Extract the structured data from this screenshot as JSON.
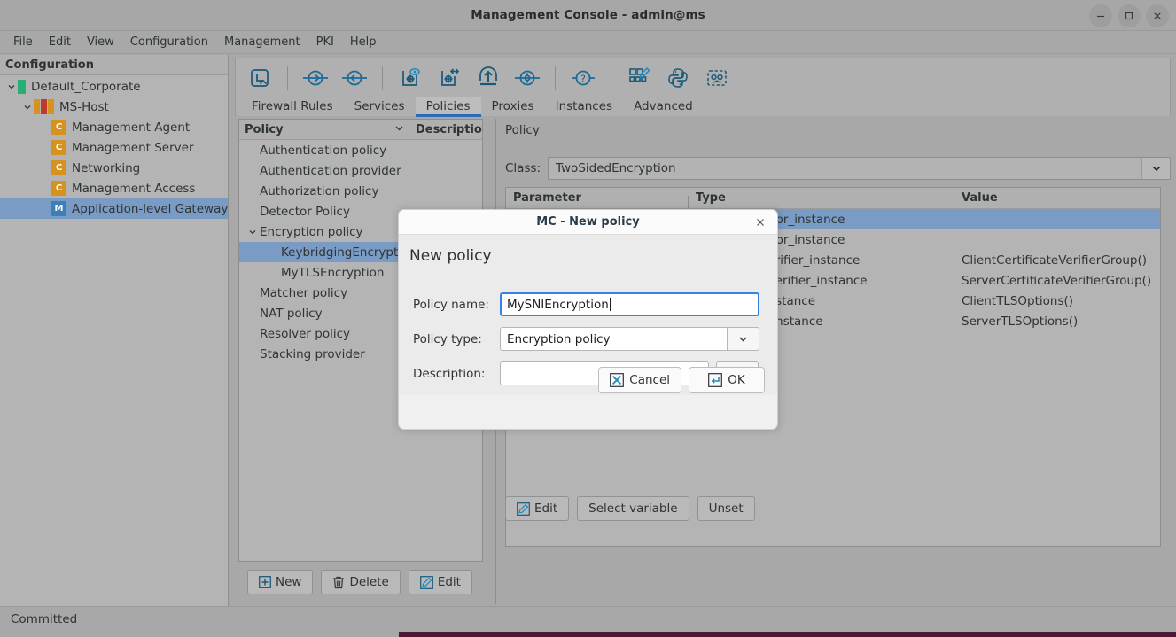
{
  "window": {
    "title": "Management Console - admin@ms",
    "controls": {
      "minimize": "minimize-icon",
      "maximize": "maximize-icon",
      "close": "close-icon"
    }
  },
  "menubar": {
    "items": [
      "File",
      "Edit",
      "View",
      "Configuration",
      "Management",
      "PKI",
      "Help"
    ]
  },
  "sidebar": {
    "header": "Configuration",
    "items": [
      {
        "label": "Default_Corporate",
        "depth": 0,
        "icon": "green-bar",
        "expanded": true,
        "selected": false
      },
      {
        "label": "MS-Host",
        "depth": 1,
        "icon": "triple-bar",
        "expanded": true,
        "selected": false
      },
      {
        "label": "Management Agent",
        "depth": 2,
        "icon": "c-badge",
        "expanded": null,
        "selected": false
      },
      {
        "label": "Management Server",
        "depth": 2,
        "icon": "c-badge",
        "expanded": null,
        "selected": false
      },
      {
        "label": "Networking",
        "depth": 2,
        "icon": "c-badge",
        "expanded": null,
        "selected": false
      },
      {
        "label": "Management Access",
        "depth": 2,
        "icon": "c-badge",
        "expanded": null,
        "selected": false
      },
      {
        "label": "Application-level Gateway",
        "depth": 2,
        "icon": "m-badge",
        "expanded": null,
        "selected": true
      }
    ]
  },
  "toolbar": {
    "icons": [
      "go-up-icon",
      "separator",
      "forward-arrow-icon",
      "back-arrow-icon",
      "separator",
      "preview-config-icon",
      "apply-config-icon",
      "upload-icon",
      "settings-icon",
      "separator",
      "help-icon",
      "separator",
      "edit-grid-icon",
      "python-icon",
      "bot-icon"
    ],
    "tabs": [
      {
        "label": "Firewall Rules",
        "active": false
      },
      {
        "label": "Services",
        "active": false
      },
      {
        "label": "Policies",
        "active": true
      },
      {
        "label": "Proxies",
        "active": false
      },
      {
        "label": "Instances",
        "active": false
      },
      {
        "label": "Advanced",
        "active": false
      }
    ],
    "accent_color": "#2d6cb5"
  },
  "policy_panel": {
    "columns": [
      "Policy",
      "Description"
    ],
    "items": [
      {
        "label": "Authentication policy",
        "depth": 1,
        "expandable": false,
        "selected": false
      },
      {
        "label": "Authentication provider",
        "depth": 1,
        "expandable": false,
        "selected": false
      },
      {
        "label": "Authorization policy",
        "depth": 1,
        "expandable": false,
        "selected": false
      },
      {
        "label": "Detector Policy",
        "depth": 1,
        "expandable": false,
        "selected": false
      },
      {
        "label": "Encryption policy",
        "depth": 1,
        "expandable": true,
        "expanded": true,
        "selected": false
      },
      {
        "label": "KeybridgingEncryption",
        "depth": 2,
        "expandable": false,
        "selected": true
      },
      {
        "label": "MyTLSEncryption",
        "depth": 2,
        "expandable": false,
        "selected": false
      },
      {
        "label": "Matcher policy",
        "depth": 1,
        "expandable": false,
        "selected": false
      },
      {
        "label": "NAT policy",
        "depth": 1,
        "expandable": false,
        "selected": false
      },
      {
        "label": "Resolver policy",
        "depth": 1,
        "expandable": false,
        "selected": false
      },
      {
        "label": "Stacking provider",
        "depth": 1,
        "expandable": false,
        "selected": false
      }
    ],
    "buttons": [
      {
        "label": "New",
        "icon": "plus-icon"
      },
      {
        "label": "Delete",
        "icon": "trash-icon"
      },
      {
        "label": "Edit",
        "icon": "pencil-icon"
      }
    ]
  },
  "right_panel": {
    "title": "Policy",
    "class_label": "Class:",
    "class_value": "TwoSidedEncryption",
    "table": {
      "headers": [
        "Parameter",
        "Type",
        "Value"
      ],
      "rows": [
        {
          "parameter": "",
          "type": "ficategenerator_instance",
          "value": "",
          "selected": true
        },
        {
          "parameter": "",
          "type": "ficategenerator_instance",
          "value": "",
          "selected": false
        },
        {
          "parameter": "",
          "type": "tcertificateverifier_instance",
          "value": "ClientCertificateVerifierGroup()",
          "selected": false
        },
        {
          "parameter": "",
          "type": "ercertificateverifier_instance",
          "value": "ServerCertificateVerifierGroup()",
          "selected": false
        },
        {
          "parameter": "",
          "type": "ttlsoptions_instance",
          "value": "ClientTLSOptions()",
          "selected": false
        },
        {
          "parameter": "",
          "type": "ertlsoptions_instance",
          "value": "ServerTLSOptions()",
          "selected": false
        }
      ]
    },
    "buttons": [
      {
        "label": "Edit",
        "icon": "pencil-icon"
      },
      {
        "label": "Select variable",
        "icon": null
      },
      {
        "label": "Unset",
        "icon": null
      }
    ]
  },
  "dialog": {
    "titlebar_title": "MC - New policy",
    "heading": "New policy",
    "fields": [
      {
        "label": "Policy name:",
        "value": "MySNIEncryption",
        "placeholder": "",
        "focused": true
      },
      {
        "label": "Policy type:",
        "value": "Encryption policy",
        "placeholder": "",
        "focused": false
      },
      {
        "label": "Description:",
        "value": "",
        "placeholder": "",
        "focused": false
      }
    ],
    "desc_browse_label": "...",
    "buttons": [
      {
        "label": "Cancel",
        "icon": "cancel-x-icon"
      },
      {
        "label": "OK",
        "icon": "enter-key-icon"
      }
    ]
  },
  "statusbar": {
    "text": "Committed"
  },
  "colors": {
    "window_bg": "#a8a8a8",
    "panel_bg": "#b4b4b4",
    "selection": "#7a9bc4",
    "accent": "#2d6cb5",
    "icon_blue": "#1a6a9a",
    "dialog_bg": "#ebebeb",
    "bottom_accent": "#4a1a33"
  }
}
